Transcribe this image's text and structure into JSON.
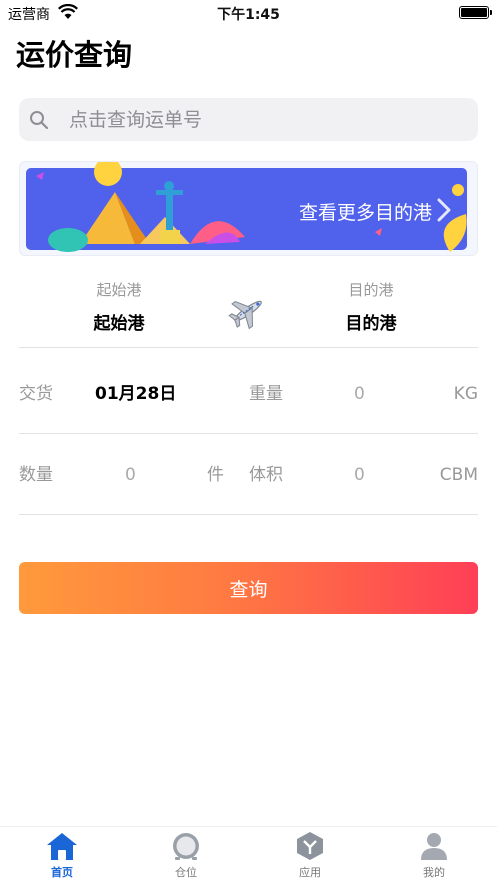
{
  "status_bar": {
    "carrier": "运营商",
    "time": "下午1:45"
  },
  "page": {
    "title": "运价查询"
  },
  "search": {
    "placeholder": "点击查询运单号"
  },
  "banner": {
    "text": "查看更多目的港"
  },
  "route": {
    "origin_label": "起始港",
    "origin_value": "起始港",
    "dest_label": "目的港",
    "dest_value": "目的港"
  },
  "form": {
    "delivery_label": "交货",
    "delivery_date": "01月28日",
    "weight_label": "重量",
    "weight_value": "0",
    "weight_unit": "KG",
    "quantity_label": "数量",
    "quantity_value": "0",
    "quantity_unit": "件",
    "volume_label": "体积",
    "volume_value": "0",
    "volume_unit": "CBM"
  },
  "actions": {
    "query_label": "查询"
  },
  "tabbar": {
    "items": [
      {
        "label": "首页",
        "icon": "home-icon",
        "active": true
      },
      {
        "label": "仓位",
        "icon": "clock-icon",
        "active": false
      },
      {
        "label": "应用",
        "icon": "apps-icon",
        "active": false
      },
      {
        "label": "我的",
        "icon": "profile-icon",
        "active": false
      }
    ]
  },
  "colors": {
    "accent": "#1a66d6",
    "button_start": "#ff9a3c",
    "button_end": "#ff3f56",
    "banner_bg": "#4c5be8"
  }
}
